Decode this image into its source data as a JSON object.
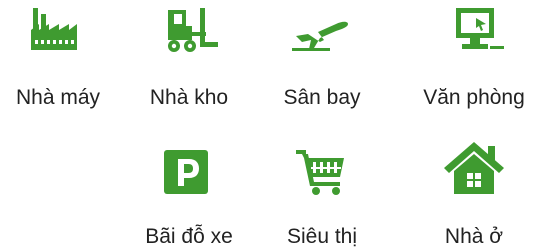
{
  "colors": {
    "accent": "#3f9b30"
  },
  "grid": {
    "items": [
      {
        "label": "Nhà máy",
        "icon": "factory-icon"
      },
      {
        "label": "Nhà kho",
        "icon": "forklift-icon"
      },
      {
        "label": "Sân bay",
        "icon": "airplane-icon"
      },
      {
        "label": "Văn phòng",
        "icon": "computer-icon"
      },
      {
        "label": "Bãi đỗ xe",
        "icon": "parking-icon"
      },
      {
        "label": "Siêu thị",
        "icon": "shopping-cart-icon"
      },
      {
        "label": "Nhà ở",
        "icon": "house-icon"
      }
    ]
  }
}
